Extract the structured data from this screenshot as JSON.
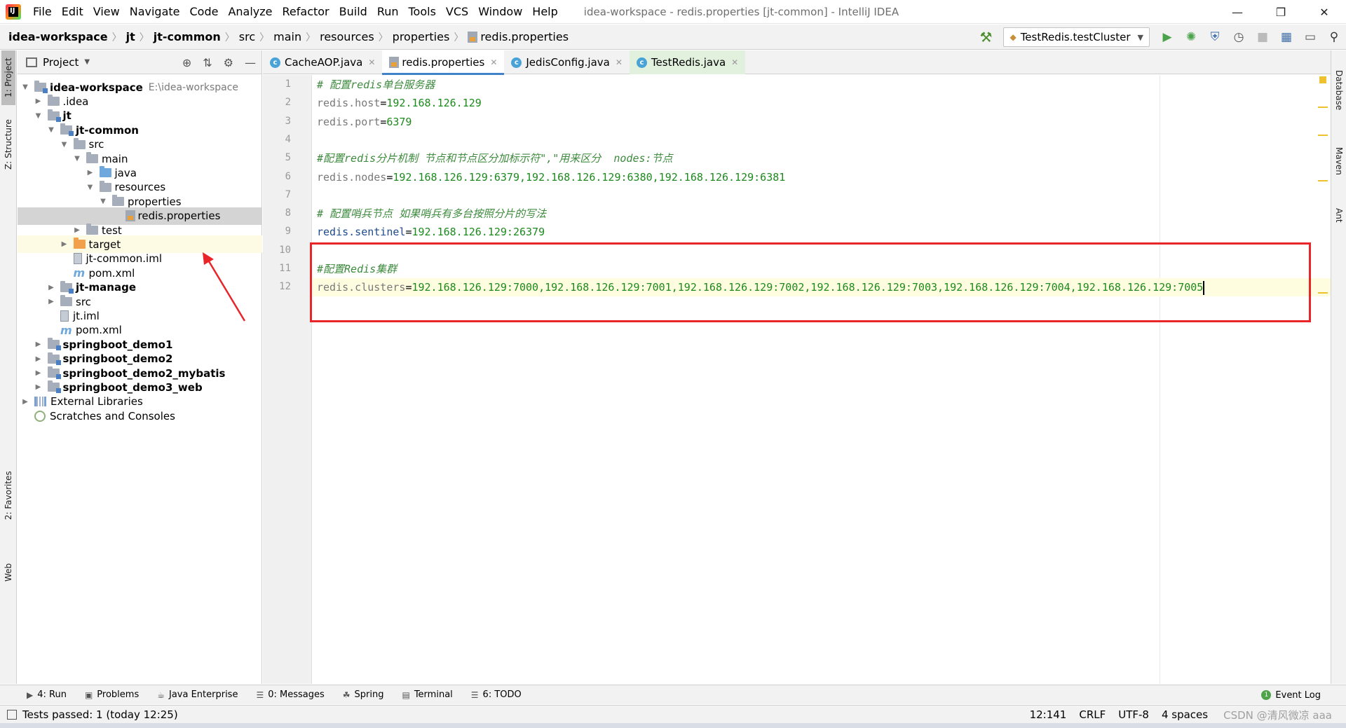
{
  "menu": {
    "items": [
      "File",
      "Edit",
      "View",
      "Navigate",
      "Code",
      "Analyze",
      "Refactor",
      "Build",
      "Run",
      "Tools",
      "VCS",
      "Window",
      "Help"
    ],
    "window_title": "idea-workspace - redis.properties [jt-common] - IntelliJ IDEA"
  },
  "breadcrumbs": [
    "idea-workspace",
    "jt",
    "jt-common",
    "src",
    "main",
    "resources",
    "properties",
    "redis.properties"
  ],
  "run_config": "TestRedis.testCluster",
  "left_tabs": [
    "1: Project",
    "Z: Structure",
    "2: Favorites",
    "Web"
  ],
  "right_tabs": [
    "Database",
    "Maven",
    "Ant"
  ],
  "project_panel": {
    "title": "Project",
    "tree": [
      {
        "label": "idea-workspace",
        "path": "E:\\idea-workspace",
        "depth": 0,
        "expanded": true,
        "type": "module",
        "bold": true
      },
      {
        "label": ".idea",
        "depth": 1,
        "expanded": false,
        "type": "folder"
      },
      {
        "label": "jt",
        "depth": 1,
        "expanded": true,
        "type": "module",
        "bold": true
      },
      {
        "label": "jt-common",
        "depth": 2,
        "expanded": true,
        "type": "module",
        "bold": true
      },
      {
        "label": "src",
        "depth": 3,
        "expanded": true,
        "type": "folder"
      },
      {
        "label": "main",
        "depth": 4,
        "expanded": true,
        "type": "folder"
      },
      {
        "label": "java",
        "depth": 5,
        "expanded": false,
        "type": "src"
      },
      {
        "label": "resources",
        "depth": 5,
        "expanded": true,
        "type": "res"
      },
      {
        "label": "properties",
        "depth": 6,
        "expanded": true,
        "type": "folder"
      },
      {
        "label": "redis.properties",
        "depth": 7,
        "type": "props",
        "selected": true
      },
      {
        "label": "test",
        "depth": 4,
        "expanded": false,
        "type": "folder"
      },
      {
        "label": "target",
        "depth": 3,
        "expanded": false,
        "type": "target",
        "excluded": true
      },
      {
        "label": "jt-common.iml",
        "depth": 3,
        "type": "iml"
      },
      {
        "label": "pom.xml",
        "depth": 3,
        "type": "pom"
      },
      {
        "label": "jt-manage",
        "depth": 2,
        "expanded": false,
        "type": "module",
        "bold": true
      },
      {
        "label": "src",
        "depth": 2,
        "expanded": false,
        "type": "folder"
      },
      {
        "label": "jt.iml",
        "depth": 2,
        "type": "iml"
      },
      {
        "label": "pom.xml",
        "depth": 2,
        "type": "pom"
      },
      {
        "label": "springboot_demo1",
        "depth": 1,
        "expanded": false,
        "type": "module",
        "bold": true
      },
      {
        "label": "springboot_demo2",
        "depth": 1,
        "expanded": false,
        "type": "module",
        "bold": true
      },
      {
        "label": "springboot_demo2_mybatis",
        "depth": 1,
        "expanded": false,
        "type": "module",
        "bold": true
      },
      {
        "label": "springboot_demo3_web",
        "depth": 1,
        "expanded": false,
        "type": "module",
        "bold": true
      },
      {
        "label": "External Libraries",
        "depth": 0,
        "expanded": false,
        "type": "extlib"
      },
      {
        "label": "Scratches and Consoles",
        "depth": 0,
        "type": "scratch"
      }
    ]
  },
  "editor_tabs": [
    {
      "label": "CacheAOP.java",
      "type": "java",
      "active": false
    },
    {
      "label": "redis.properties",
      "type": "props",
      "active": true
    },
    {
      "label": "JedisConfig.java",
      "type": "java",
      "active": false
    },
    {
      "label": "TestRedis.java",
      "type": "java",
      "active": false,
      "green": true
    }
  ],
  "code_lines": [
    {
      "n": "1",
      "parts": [
        {
          "t": "# 配置redis单台服务器",
          "c": "c-comment-green"
        }
      ]
    },
    {
      "n": "2",
      "parts": [
        {
          "t": "redis.host",
          "c": "c-key"
        },
        {
          "t": "=",
          "c": "c-eq"
        },
        {
          "t": "192.168.126.129",
          "c": "c-val"
        }
      ]
    },
    {
      "n": "3",
      "parts": [
        {
          "t": "redis.port",
          "c": "c-key"
        },
        {
          "t": "=",
          "c": "c-eq"
        },
        {
          "t": "6379",
          "c": "c-val"
        }
      ]
    },
    {
      "n": "4",
      "parts": []
    },
    {
      "n": "5",
      "parts": [
        {
          "t": "#配置redis分片机制 节点和节点区分加标示符\",\"用来区分  nodes:节点",
          "c": "c-comment-green"
        }
      ]
    },
    {
      "n": "6",
      "parts": [
        {
          "t": "redis.nodes",
          "c": "c-key"
        },
        {
          "t": "=",
          "c": "c-eq"
        },
        {
          "t": "192.168.126.129:6379,192.168.126.129:6380,192.168.126.129:6381",
          "c": "c-val"
        }
      ]
    },
    {
      "n": "7",
      "parts": []
    },
    {
      "n": "8",
      "parts": [
        {
          "t": "# 配置哨兵节点 如果哨兵有多台按照分片的写法",
          "c": "c-comment-green"
        }
      ]
    },
    {
      "n": "9",
      "parts": [
        {
          "t": "redis.sentinel",
          "c": "c-key-dark"
        },
        {
          "t": "=",
          "c": "c-eq"
        },
        {
          "t": "192.168.126.129:26379",
          "c": "c-val"
        }
      ]
    },
    {
      "n": "10",
      "parts": []
    },
    {
      "n": "11",
      "parts": [
        {
          "t": "#配置Redis集群",
          "c": "c-comment-green"
        }
      ]
    },
    {
      "n": "12",
      "parts": [
        {
          "t": "redis.clusters",
          "c": "c-key"
        },
        {
          "t": "=",
          "c": "c-eq"
        },
        {
          "t": "192.168.126.129:7000,192.168.126.129:7001,192.168.126.129:7002,192.168.126.129:7003,192.168.126.129:7004,192.168.126.129:7005",
          "c": "c-val"
        }
      ],
      "current": true
    }
  ],
  "bottom_tools": [
    {
      "label": "4: Run",
      "icon": "run-icon"
    },
    {
      "label": "Problems",
      "icon": "problems-icon"
    },
    {
      "label": "Java Enterprise",
      "icon": "java-enterprise-icon"
    },
    {
      "label": "0: Messages",
      "icon": "messages-icon"
    },
    {
      "label": "Spring",
      "icon": "spring-icon"
    },
    {
      "label": "Terminal",
      "icon": "terminal-icon"
    },
    {
      "label": "6: TODO",
      "icon": "todo-icon"
    }
  ],
  "event_log": "Event Log",
  "status": {
    "message": "Tests passed: 1 (today 12:25)",
    "position": "12:141",
    "line_sep": "CRLF",
    "encoding": "UTF-8",
    "indent": "4 spaces",
    "watermark": "CSDN @清风微凉 aaa"
  },
  "colors": {
    "accent": "#4083c9",
    "annotation_red": "#e8262a",
    "string_green": "#1c8a1c"
  }
}
